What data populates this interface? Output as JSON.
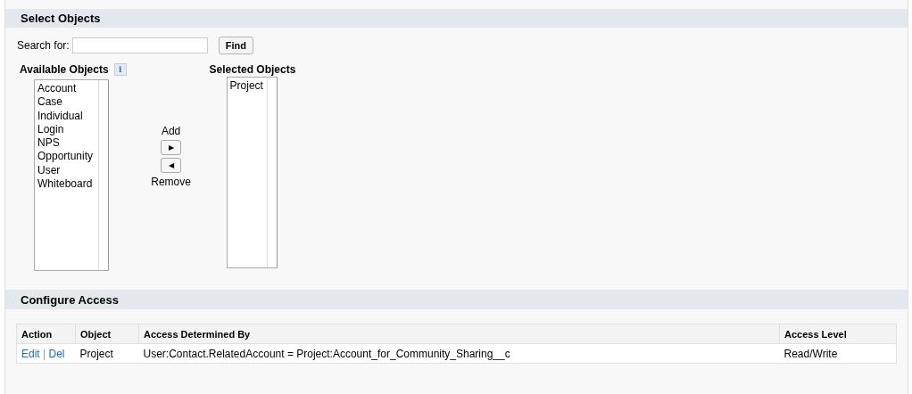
{
  "select_objects": {
    "title": "Select Objects",
    "search": {
      "label": "Search  for:",
      "button": "Find"
    },
    "available": {
      "label": "Available Objects",
      "info": "i",
      "items": [
        "Account",
        "Case",
        "Individual",
        "Login",
        "NPS",
        "Opportunity",
        "User",
        "Whiteboard"
      ]
    },
    "add": {
      "label": "Add",
      "arrow": "▶"
    },
    "remove": {
      "label": "Remove",
      "arrow": "◀"
    },
    "selected": {
      "label": "Selected Objects",
      "items": [
        "Project"
      ]
    }
  },
  "configure_access": {
    "title": "Configure Access",
    "table": {
      "columns": [
        "Action",
        "Object",
        "Access Determined By",
        "Access Level"
      ],
      "rows": [
        {
          "actions": [
            "Edit",
            "Del"
          ],
          "separator": "|",
          "object": "Project",
          "determined_by": "User:Contact.RelatedAccount = Project:Account_for_Community_Sharing__c",
          "access_level": "Read/Write"
        }
      ]
    }
  }
}
